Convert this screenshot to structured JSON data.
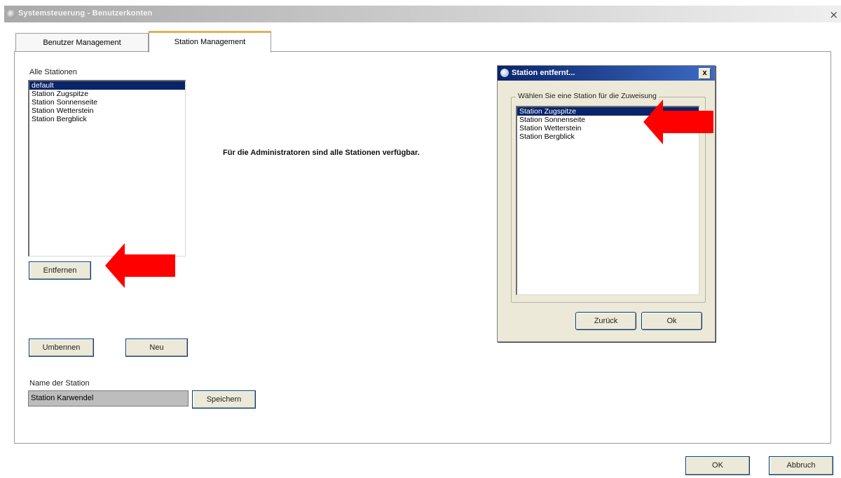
{
  "window": {
    "title": "Systemsteuerung - Benutzerkonten",
    "close_glyph": "×"
  },
  "tabs": [
    {
      "label": "Benutzer Management",
      "active": false
    },
    {
      "label": "Station Management",
      "active": true
    }
  ],
  "stations_panel": {
    "list_label": "Alle Stationen",
    "stations": [
      {
        "label": "default",
        "selected": true
      },
      {
        "label": "Station Zugspitze",
        "selected": false
      },
      {
        "label": "Station Sonnenseite",
        "selected": false
      },
      {
        "label": "Station Wetterstein",
        "selected": false
      },
      {
        "label": "Station Bergblick",
        "selected": false
      }
    ],
    "remove_button": "Entfernen",
    "rename_button": "Umbennen",
    "new_button": "Neu",
    "name_label": "Name der Station",
    "name_value": "Station Karwendel",
    "save_button": "Speichern"
  },
  "info_message": "Für die Administratoren sind alle Stationen verfügbar.",
  "dialog": {
    "title": "Station entfernt...",
    "close_glyph": "x",
    "group_label": "Wählen Sie eine Station für die Zuweisung",
    "stations": [
      {
        "label": "Station Zugspitze",
        "selected": true
      },
      {
        "label": "Station Sonnenseite",
        "selected": false
      },
      {
        "label": "Station Wetterstein",
        "selected": false
      },
      {
        "label": "Station Bergblick",
        "selected": false
      }
    ],
    "back_button": "Zurück",
    "ok_button": "Ok"
  },
  "footer": {
    "ok_button": "OK",
    "cancel_button": "Abbruch"
  },
  "annotations": {
    "arrow_color": "#ff0000",
    "arrow_icon": "red-arrow-left-icon"
  },
  "colors": {
    "selection": "#0a246a",
    "active_tab_accent": "#e3b15a",
    "dialog_background": "#ece9d8"
  }
}
